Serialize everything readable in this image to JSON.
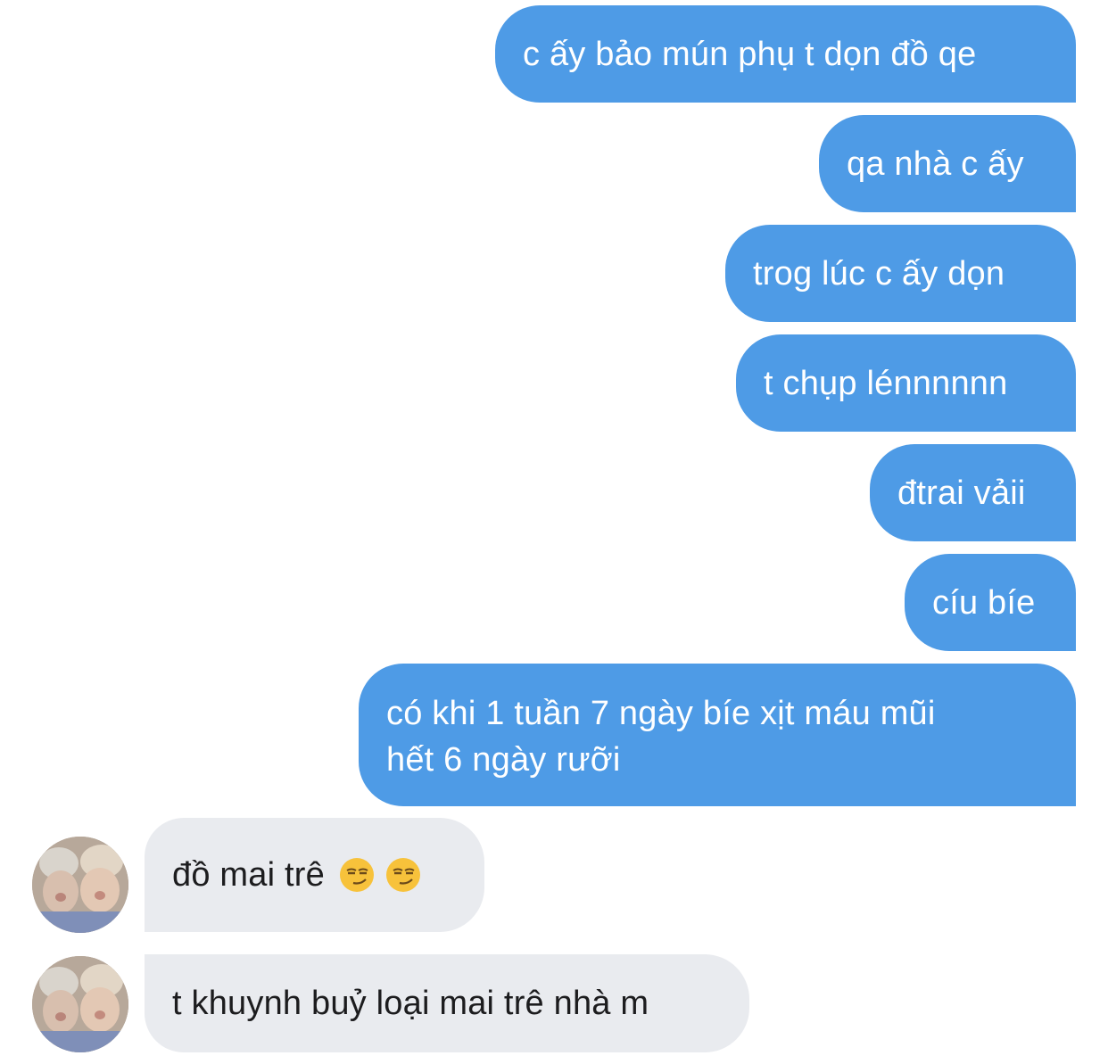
{
  "conversation": {
    "outgoing": [
      {
        "text": "c ấy bảo mún phụ t dọn đồ qe"
      },
      {
        "text": "qa nhà c ấy"
      },
      {
        "text": "trog lúc c ấy dọn"
      },
      {
        "text": "t chụp lénnnnnn"
      },
      {
        "text": "đtrai vảii"
      },
      {
        "text": "cíu bíe"
      },
      {
        "text": "có khi 1 tuần 7 ngày bíe xịt máu mũi\nhết 6 ngày rưỡi"
      }
    ],
    "incoming": [
      {
        "text": "đồ mai trê",
        "emojis": [
          "smirking-face-emoji",
          "smirking-face-emoji"
        ]
      },
      {
        "text": "t khuynh buỷ loại mai trê nhà m"
      }
    ]
  },
  "colors": {
    "outgoing_bubble": "#4e9be6",
    "incoming_bubble": "#e9ebef",
    "emoji_face": "#f7c23b"
  }
}
